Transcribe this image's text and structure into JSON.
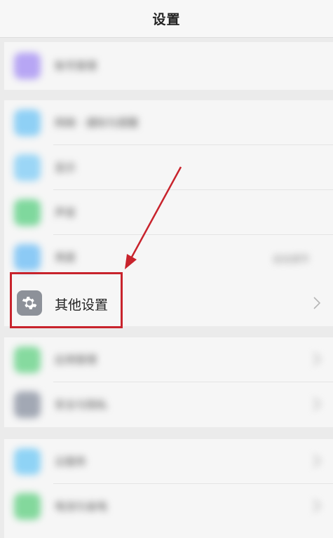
{
  "header": {
    "title": "设置"
  },
  "groups": [
    {
      "items": [
        {
          "label": "账号管理",
          "icon": "account-icon",
          "color": "#b7a6f4"
        }
      ]
    },
    {
      "items": [
        {
          "label": "网络 · 通知与提醒",
          "icon": "network-icon",
          "color": "#8fd0f5"
        },
        {
          "label": "显示",
          "icon": "display-icon",
          "color": "#9bd6f6"
        },
        {
          "label": "声音",
          "icon": "sound-icon",
          "color": "#7fd89d"
        },
        {
          "label": "亮度",
          "icon": "brightness-icon",
          "color": "#8ccaf5",
          "value": "自动调节"
        }
      ]
    },
    {
      "items": [
        {
          "label": "应用管理",
          "icon": "apps-icon",
          "color": "#86da9f"
        },
        {
          "label": "安全与隐私",
          "icon": "security-icon",
          "color": "#a2a8b4"
        }
      ]
    },
    {
      "items": [
        {
          "label": "云服务",
          "icon": "cloud-icon",
          "color": "#8fd3f5"
        },
        {
          "label": "电池与省电",
          "icon": "battery-icon",
          "color": "#83d89c"
        }
      ]
    }
  ],
  "focus_item": {
    "label": "其他设置",
    "icon": "gear-icon",
    "color": "#8d9199"
  },
  "annotation": {
    "color": "#c8232c",
    "icon": "red-arrow-icon"
  }
}
